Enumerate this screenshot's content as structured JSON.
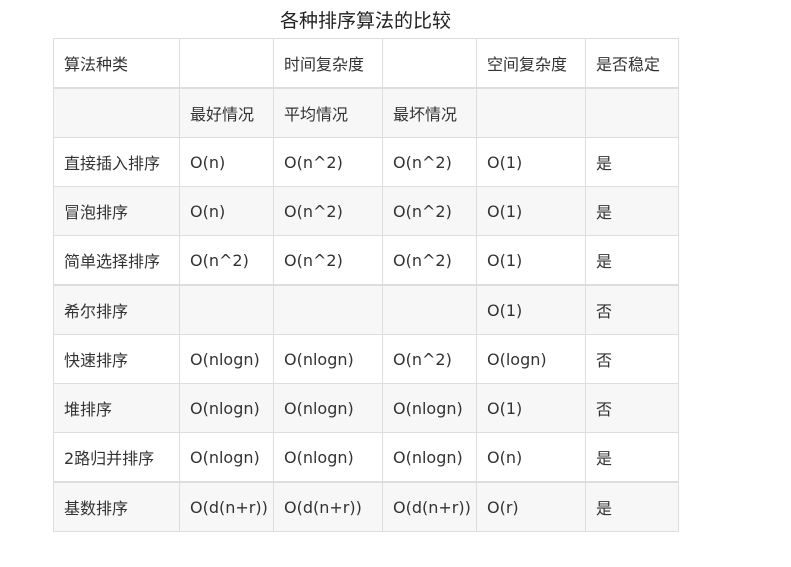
{
  "caption": "各种排序算法的比较",
  "header_row_1": [
    "算法种类",
    "",
    "时间复杂度",
    "",
    "空间复杂度",
    "是否稳定"
  ],
  "header_row_2": [
    "",
    "最好情况",
    "平均情况",
    "最坏情况",
    "",
    ""
  ],
  "rows": [
    [
      "直接插入排序",
      "O(n)",
      "O(n^2)",
      "O(n^2)",
      "O(1)",
      "是"
    ],
    [
      "冒泡排序",
      "O(n)",
      "O(n^2)",
      "O(n^2)",
      "O(1)",
      "是"
    ],
    [
      "简单选择排序",
      "O(n^2)",
      "O(n^2)",
      "O(n^2)",
      "O(1)",
      "是"
    ],
    [
      "希尔排序",
      "",
      "",
      "",
      "O(1)",
      "否"
    ],
    [
      "快速排序",
      "O(nlogn)",
      "O(nlogn)",
      "O(n^2)",
      "O(logn)",
      "否"
    ],
    [
      "堆排序",
      "O(nlogn)",
      "O(nlogn)",
      "O(nlogn)",
      "O(1)",
      "否"
    ],
    [
      "2路归并排序",
      "O(nlogn)",
      "O(nlogn)",
      "O(nlogn)",
      "O(n)",
      "是"
    ],
    [
      "基数排序",
      "O(d(n+r))",
      "O(d(n+r))",
      "O(d(n+r))",
      "O(r)",
      "是"
    ]
  ]
}
